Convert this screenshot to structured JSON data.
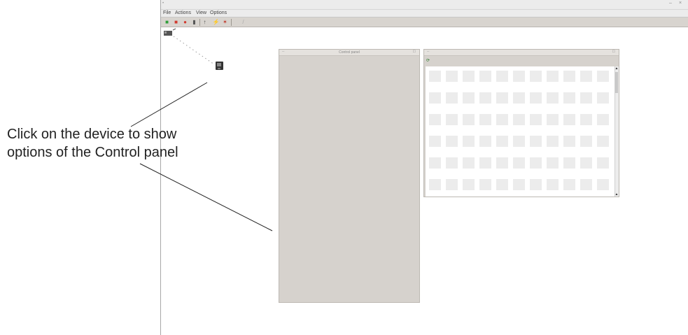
{
  "window": {
    "title": ""
  },
  "menu": {
    "items": [
      "File",
      "Actions",
      "View",
      "Options"
    ],
    "right": ""
  },
  "toolbar": {
    "icons": [
      "add-icon",
      "stop-icon",
      "refresh-icon",
      "info-icon",
      "antenna-icon",
      "plug-icon",
      "scan-icon",
      "edit-icon"
    ]
  },
  "devices": {
    "root_label": "",
    "node_label": "",
    "node_caption": ""
  },
  "control_panel": {
    "title": "Control panel",
    "line1": "",
    "line2": ""
  },
  "grid_panel": {
    "title": "",
    "toolbar_label": "",
    "cell_count": 88
  },
  "annotation": {
    "line1": "Click on the device to show",
    "line2": "options of the Control panel"
  }
}
